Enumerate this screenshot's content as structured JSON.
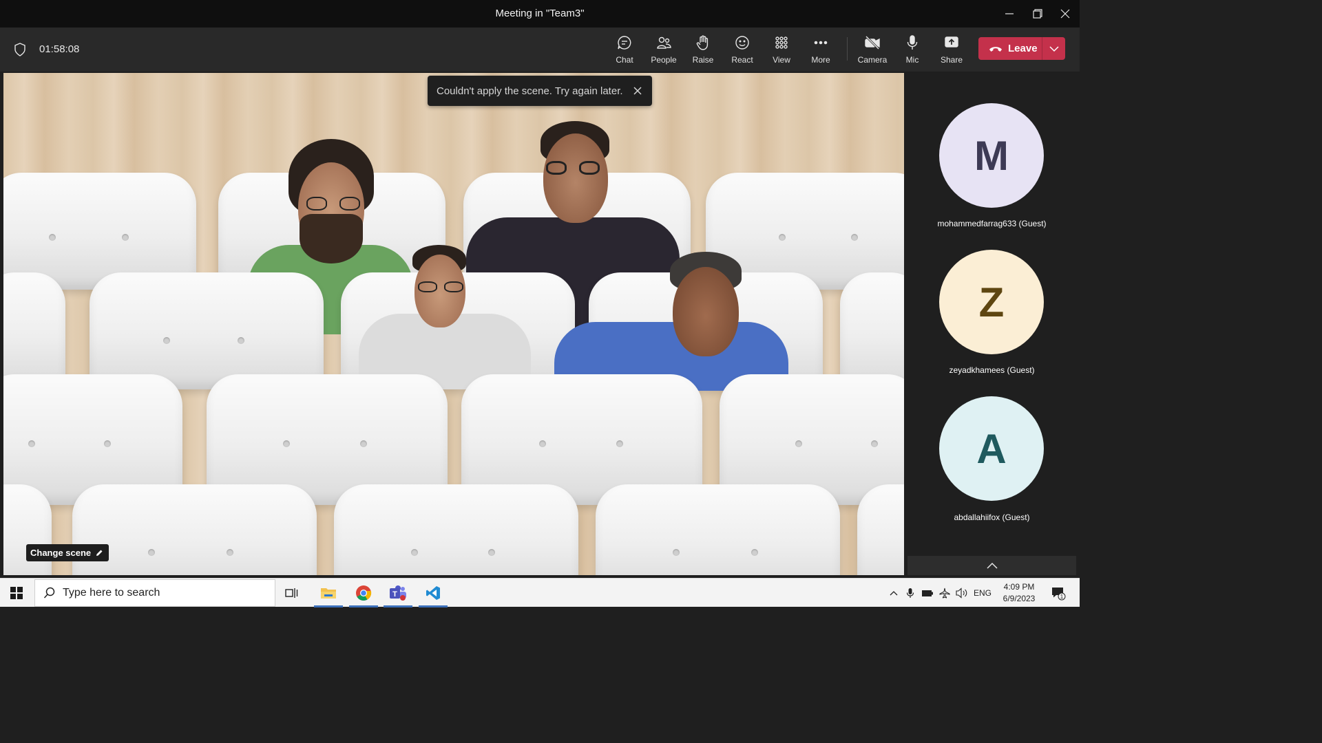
{
  "window": {
    "title": "Meeting in \"Team3\""
  },
  "meeting": {
    "timer": "01:58:08",
    "toolbar": {
      "chat": "Chat",
      "people": "People",
      "raise": "Raise",
      "react": "React",
      "view": "View",
      "more": "More",
      "camera": "Camera",
      "mic": "Mic",
      "share": "Share",
      "leave": "Leave"
    },
    "toast": {
      "message": "Couldn't apply the scene. Try again later."
    },
    "change_scene": "Change scene",
    "colors": {
      "leave": "#c4314b",
      "toolbar": "#292929",
      "panel": "#1f1f1f"
    }
  },
  "participants": [
    {
      "initial": "M",
      "name": "mohammedfarrag633 (Guest)",
      "bg": "#e7e3f4",
      "fg": "#3d3a55"
    },
    {
      "initial": "Z",
      "name": "zeyadkhamees (Guest)",
      "bg": "#fbeed5",
      "fg": "#5e4611"
    },
    {
      "initial": "A",
      "name": "abdallahiifox (Guest)",
      "bg": "#dff1f3",
      "fg": "#1f5a5e"
    }
  ],
  "taskbar": {
    "search_placeholder": "Type here to search",
    "apps": [
      "task-view",
      "file-explorer",
      "chrome",
      "teams",
      "vscode"
    ],
    "lang": "ENG",
    "time": "4:09 PM",
    "date": "6/9/2023",
    "notification_count": "1"
  }
}
